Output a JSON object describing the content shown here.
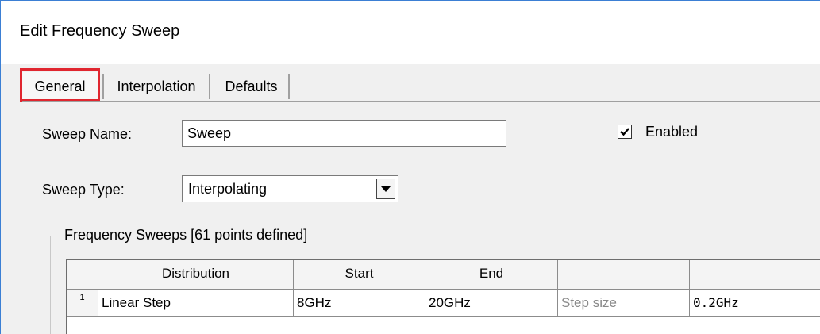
{
  "window": {
    "title": "Edit Frequency Sweep"
  },
  "tabs": [
    {
      "label": "General",
      "active": true
    },
    {
      "label": "Interpolation",
      "active": false
    },
    {
      "label": "Defaults",
      "active": false
    }
  ],
  "form": {
    "sweep_name_label": "Sweep Name:",
    "sweep_name_value": "Sweep",
    "enabled_label": "Enabled",
    "enabled_checked": true,
    "sweep_type_label": "Sweep Type:",
    "sweep_type_value": "Interpolating"
  },
  "frequency_sweeps": {
    "group_label": "Frequency Sweeps [61 points defined]",
    "columns": [
      "",
      "Distribution",
      "Start",
      "End",
      "",
      ""
    ],
    "rows": [
      {
        "index": "1",
        "distribution": "Linear Step",
        "start": "8GHz",
        "end": "20GHz",
        "param_label": "Step size",
        "param_value": "0.2GHz"
      }
    ]
  },
  "colors": {
    "highlight": "#e0262f",
    "window_border": "#3b7fd4",
    "dialog_bg": "#f0f0f0"
  }
}
